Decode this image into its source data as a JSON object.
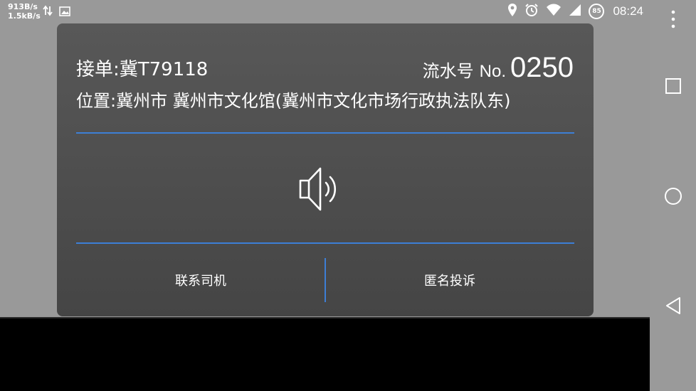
{
  "status_bar": {
    "net_speed_up": "913B/s",
    "net_speed_down": "1.5kB/s",
    "battery_level": "85",
    "time": "08:24",
    "icons": [
      "data-transfer-icon",
      "image-icon",
      "location-icon",
      "alarm-icon",
      "wifi-icon",
      "signal-icon",
      "battery-icon"
    ]
  },
  "dialog": {
    "order_label": "接单:冀T79118",
    "serial_label": "流水号",
    "serial_no": "No.",
    "serial_number": "0250",
    "location": "位置:冀州市 冀州市文化馆(冀州市文化市场行政执法队东)",
    "speaker_icon": "speaker-icon",
    "contact_driver": "联系司机",
    "anonymous_complaint": "匿名投诉",
    "accent_color": "#3d7fd6"
  },
  "nav_bar": {
    "buttons": [
      "more-icon",
      "recents-icon",
      "home-icon",
      "back-icon"
    ]
  }
}
